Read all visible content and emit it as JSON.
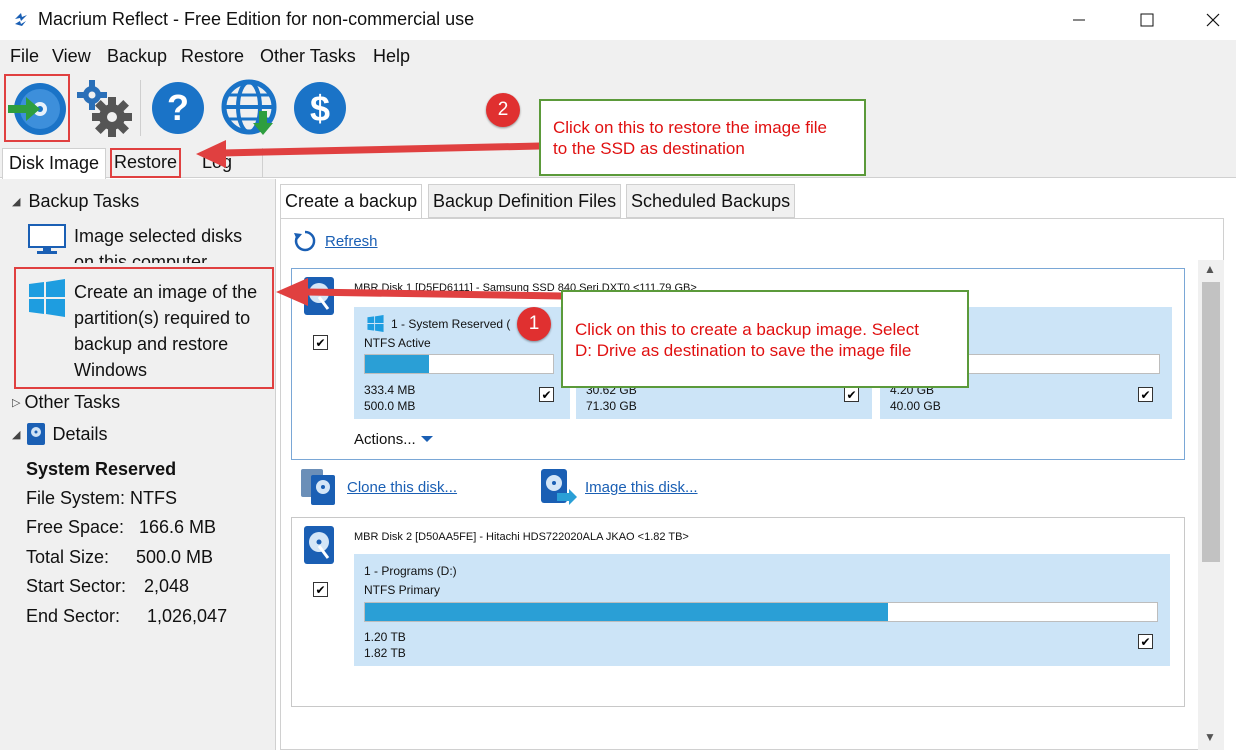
{
  "window": {
    "title": "Macrium Reflect - Free Edition for non-commercial use"
  },
  "menu": [
    "File",
    "View",
    "Backup",
    "Restore",
    "Other Tasks",
    "Help"
  ],
  "toolbar": {
    "icons": [
      "disk-image-icon",
      "settings-icon",
      "help-icon",
      "web-update-icon",
      "dollar-icon"
    ]
  },
  "left_tabs": [
    "Disk Image",
    "Restore",
    "Log"
  ],
  "left_panel": {
    "backup_tasks": "Backup Tasks",
    "task1": [
      "Image selected disks",
      "on this computer"
    ],
    "task2": [
      "Create an image of the",
      "partition(s) required to",
      "backup and restore",
      "Windows"
    ],
    "other_tasks": "Other Tasks",
    "details": "Details",
    "details_title": "System Reserved",
    "details_rows": [
      {
        "label": "File System:",
        "value": "NTFS"
      },
      {
        "label": "Free Space:",
        "value": "166.6 MB"
      },
      {
        "label": "Total Size:",
        "value": "500.0 MB"
      },
      {
        "label": "Start Sector:",
        "value": "2,048"
      },
      {
        "label": "End Sector:",
        "value": "1,026,047"
      }
    ]
  },
  "right_tabs": [
    "Create a backup",
    "Backup Definition Files",
    "Scheduled Backups"
  ],
  "refresh": "Refresh",
  "disk1": {
    "title": "MBR Disk 1 [D5FD6111] - Samsung  SSD 840 Seri     DXT0  <111.79 GB>",
    "partitions": [
      {
        "name": "1 - System Reserved (",
        "type": "NTFS Active",
        "used": "333.4 MB",
        "total": "500.0 MB",
        "fill": 0.34
      },
      {
        "name": "",
        "type": "",
        "used": "30.62 GB",
        "total": "71.30 GB",
        "fill": 0.43
      },
      {
        "name": "",
        "type": "",
        "used": "4.20 GB",
        "total": "40.00 GB",
        "fill": 0.1
      }
    ],
    "actions": "Actions..."
  },
  "disk_links": {
    "clone": "Clone this disk...",
    "image": "Image this disk..."
  },
  "disk2": {
    "title": "MBR Disk 2 [D50AA5FE] - Hitachi  HDS722020ALA     JKAO  <1.82 TB>",
    "partition": {
      "name": "1 - Programs (D:)",
      "type": "NTFS Primary",
      "used": "1.20 TB",
      "total": "1.82 TB",
      "fill": 0.66
    }
  },
  "annotations": {
    "badge1": "1",
    "badge2": "2",
    "callout1": [
      "Click on this to create a backup image. Select",
      "D: Drive  as destination to save the image file"
    ],
    "callout2": [
      "Click on this to restore the image file",
      "to the SSD as destination"
    ]
  },
  "colors": {
    "partition_bg": "#cce4f7",
    "bar_fill": "#2a9fd6",
    "annotation_red": "#e04040",
    "callout_border": "#5b9a3a",
    "link": "#1a5fb4"
  }
}
